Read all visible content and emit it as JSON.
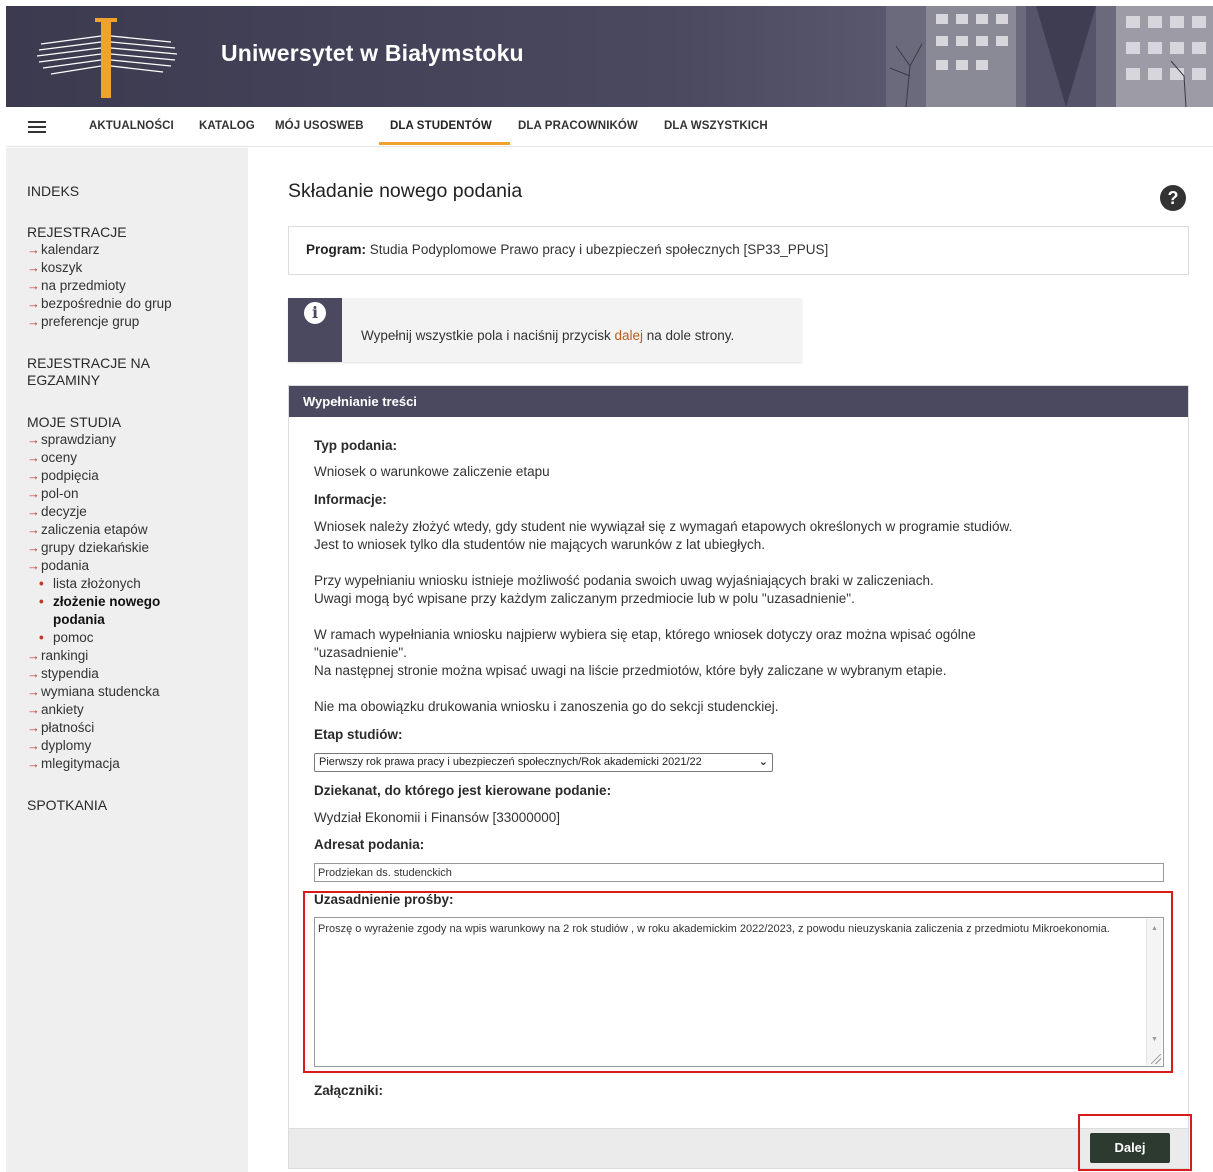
{
  "header": {
    "title": "Uniwersytet w Białymstoku"
  },
  "nav": {
    "items": [
      "AKTUALNOŚCI",
      "KATALOG",
      "MÓJ USOSWEB",
      "DLA STUDENTÓW",
      "DLA PRACOWNIKÓW",
      "DLA WSZYSTKICH"
    ],
    "active": "DLA STUDENTÓW",
    "accent_color": "#f0a22e"
  },
  "sidebar": {
    "indeks": "INDEKS",
    "rejestracje": {
      "title": "REJESTRACJE",
      "items": [
        "kalendarz",
        "koszyk",
        "na przedmioty",
        "bezpośrednie do grup",
        "preferencje grup"
      ]
    },
    "rejestracje_egzaminy": {
      "line1": "REJESTRACJE NA",
      "line2": "EGZAMINY"
    },
    "moje_studia": {
      "title": "MOJE STUDIA",
      "items_before": [
        "sprawdziany",
        "oceny",
        "podpięcia",
        "pol-on",
        "decyzje",
        "zaliczenia etapów",
        "grupy dziekańskie",
        "podania"
      ],
      "podania_sub": {
        "lista": "lista złożonych",
        "current_line1": "złożenie nowego",
        "current_line2": "podania",
        "pomoc": "pomoc"
      },
      "items_after": [
        "rankingi",
        "stypendia",
        "wymiana studencka",
        "ankiety",
        "płatności",
        "dyplomy",
        "mlegitymacja"
      ]
    },
    "spotkania": "SPOTKANIA"
  },
  "main": {
    "title": "Składanie nowego podania",
    "help_icon": "help-circle-icon",
    "program": {
      "label": "Program:",
      "value": "Studia Podyplomowe Prawo pracy i ubezpieczeń społecznych [SP33_PPUS]"
    },
    "info": {
      "icon": "info-icon",
      "text_before": "Wypełnij wszystkie pola i naciśnij przycisk ",
      "link": "dalej",
      "text_after": " na dole strony."
    },
    "panel": {
      "heading": "Wypełnianie treści",
      "typ_label": "Typ podania:",
      "typ_value": "Wniosek o warunkowe zaliczenie etapu",
      "info_label": "Informacje:",
      "info_lines": [
        "Wniosek należy złożyć wtedy, gdy student nie wywiązał się z wymagań etapowych określonych w programie studiów.",
        "Jest to wniosek tylko dla studentów nie mających warunków z lat ubiegłych.",
        "Przy wypełnianiu wniosku istnieje możliwość podania swoich uwag wyjaśniających braki w zaliczeniach.",
        "Uwagi mogą być wpisane przy każdym zaliczanym przedmiocie lub w polu \"uzasadnienie\".",
        "W ramach wypełniania wniosku najpierw wybiera się etap, którego wniosek dotyczy oraz można wpisać ogólne",
        "\"uzasadnienie\".",
        "Na następnej stronie można wpisać uwagi na liście przedmiotów, które były zaliczane w wybranym etapie.",
        "Nie ma obowiązku drukowania wniosku i zanoszenia go do sekcji studenckiej."
      ],
      "etap_label": "Etap studiów:",
      "etap_selected": "Pierwszy rok prawa pracy i ubezpieczeń społecznych/Rok akademicki 2021/22",
      "dziekanat_label": "Dziekanat, do którego jest kierowane podanie:",
      "dziekanat_value": "Wydział Ekonomii i Finansów [33000000]",
      "adresat_label": "Adresat podania:",
      "adresat_value": "Prodziekan ds. studenckich",
      "uzasadnienie_label": "Uzasadnienie prośby:",
      "uzasadnienie_value": "Proszę o wyrażenie zgody na wpis warunkowy na 2 rok studiów , w roku akademickim 2022/2023, z powodu nieuzyskania zaliczenia z przedmiotu Mikroekonomia.",
      "zalaczniki_label": "Załączniki:"
    },
    "button_next": "Dalej"
  },
  "colors": {
    "header_bg": "#4a4960",
    "highlight_border": "#d81c1c",
    "button_bg": "#2c3a30"
  }
}
